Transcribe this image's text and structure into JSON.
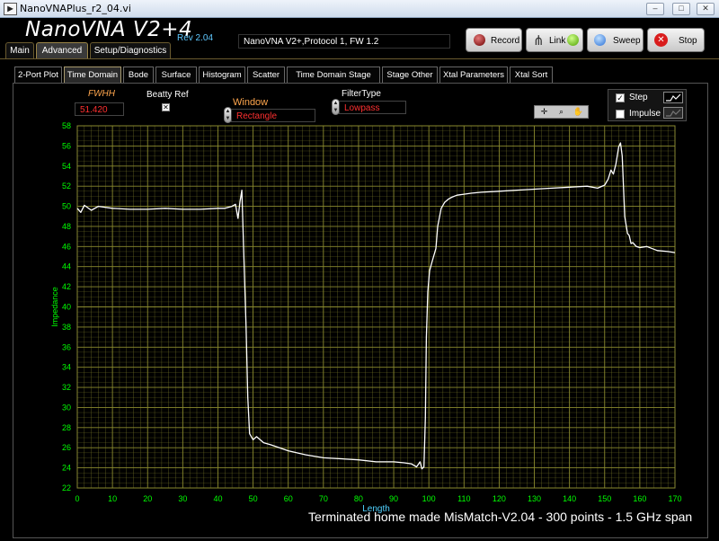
{
  "window": {
    "title": "NanoVNAPlus_r2_04.vi"
  },
  "brand": {
    "name": "NanoVNA V2+4",
    "rev": "Rev 2.04"
  },
  "status": {
    "text": "NanoVNA V2+,Protocol 1, FW 1.2"
  },
  "buttons": {
    "record": "Record",
    "link": "Link",
    "sweep": "Sweep",
    "stop": "Stop"
  },
  "colors": {
    "accent": "#ffff00",
    "grid": "#8a8a2e",
    "plot_bg": "#000000",
    "tick_text": "#00ff00",
    "value_text": "#ff3030",
    "label_text": "#ffa64d"
  },
  "main_tabs": [
    "Main",
    "Advanced",
    "Setup/Diagnostics"
  ],
  "sub_tabs": [
    "2-Port Plot",
    "Time Domain",
    "Bode",
    "Surface",
    "Histogram",
    "Scatter",
    "Time Domain Stage Test",
    "Stage Other",
    "Xtal Parameters",
    "Xtal Sort"
  ],
  "controls": {
    "fwhh_label": "FWHH",
    "fwhh_value": "51.420",
    "beatty_label": "Beatty Ref",
    "window_label": "Window",
    "window_value": "Rectangle",
    "filter_label": "FilterType",
    "filter_value": "Lowpass"
  },
  "legend": {
    "step": "Step",
    "impulse": "Impulse",
    "step_checked": true,
    "impulse_checked": false
  },
  "footer": "Terminated home made MisMatch-V2.04 - 300 points - 1.5 GHz span",
  "chart_data": {
    "type": "line",
    "title": "",
    "xlabel": "Length",
    "ylabel": "Impedance",
    "xlim": [
      0,
      170
    ],
    "ylim": [
      22,
      58
    ],
    "x_ticks": [
      0,
      10,
      20,
      30,
      40,
      50,
      60,
      70,
      80,
      90,
      100,
      110,
      120,
      130,
      140,
      150,
      160,
      170
    ],
    "y_ticks": [
      22,
      24,
      26,
      28,
      30,
      32,
      34,
      36,
      38,
      40,
      42,
      44,
      46,
      48,
      50,
      52,
      54,
      56,
      58
    ],
    "grid": true,
    "series": [
      {
        "values_x": [
          0,
          1,
          2,
          4,
          6,
          10,
          15,
          20,
          25,
          30,
          35,
          40,
          42,
          44,
          45,
          45.7,
          46.3,
          46.8,
          47.3,
          48,
          48.5,
          49,
          50,
          51,
          53,
          55,
          60,
          65,
          70,
          75,
          80,
          85,
          90,
          93,
          95,
          96.5,
          97.5,
          98,
          98.6,
          99,
          99.3,
          99.7,
          100.2,
          101,
          102,
          102.5,
          103.5,
          104.5,
          105.5,
          106.5,
          108,
          110,
          112,
          115,
          120,
          125,
          130,
          135,
          140,
          145,
          148,
          150,
          151,
          151.8,
          152.5,
          153.2,
          154,
          154.5,
          155,
          155.7,
          156.5,
          157,
          157.5,
          158,
          159,
          160,
          162,
          165,
          168,
          170
        ],
        "values_y": [
          49.8,
          49.4,
          50.1,
          49.6,
          50.0,
          49.8,
          49.7,
          49.7,
          49.8,
          49.7,
          49.7,
          49.8,
          49.8,
          50.0,
          50.2,
          48.8,
          50.5,
          51.6,
          46.0,
          38.0,
          31.0,
          27.4,
          26.8,
          27.1,
          26.5,
          26.3,
          25.7,
          25.3,
          25.0,
          24.9,
          24.8,
          24.6,
          24.6,
          24.5,
          24.4,
          24.1,
          24.6,
          23.9,
          24.1,
          29.0,
          37.0,
          41.5,
          43.6,
          44.6,
          45.8,
          48.0,
          49.8,
          50.4,
          50.7,
          50.9,
          51.1,
          51.2,
          51.3,
          51.4,
          51.5,
          51.6,
          51.7,
          51.8,
          51.9,
          52.0,
          51.8,
          52.1,
          52.7,
          53.6,
          53.2,
          54.2,
          55.9,
          56.3,
          55.0,
          49.0,
          47.3,
          47.1,
          46.3,
          46.4,
          46.0,
          45.9,
          46.0,
          45.6,
          45.5,
          45.4
        ]
      }
    ]
  }
}
